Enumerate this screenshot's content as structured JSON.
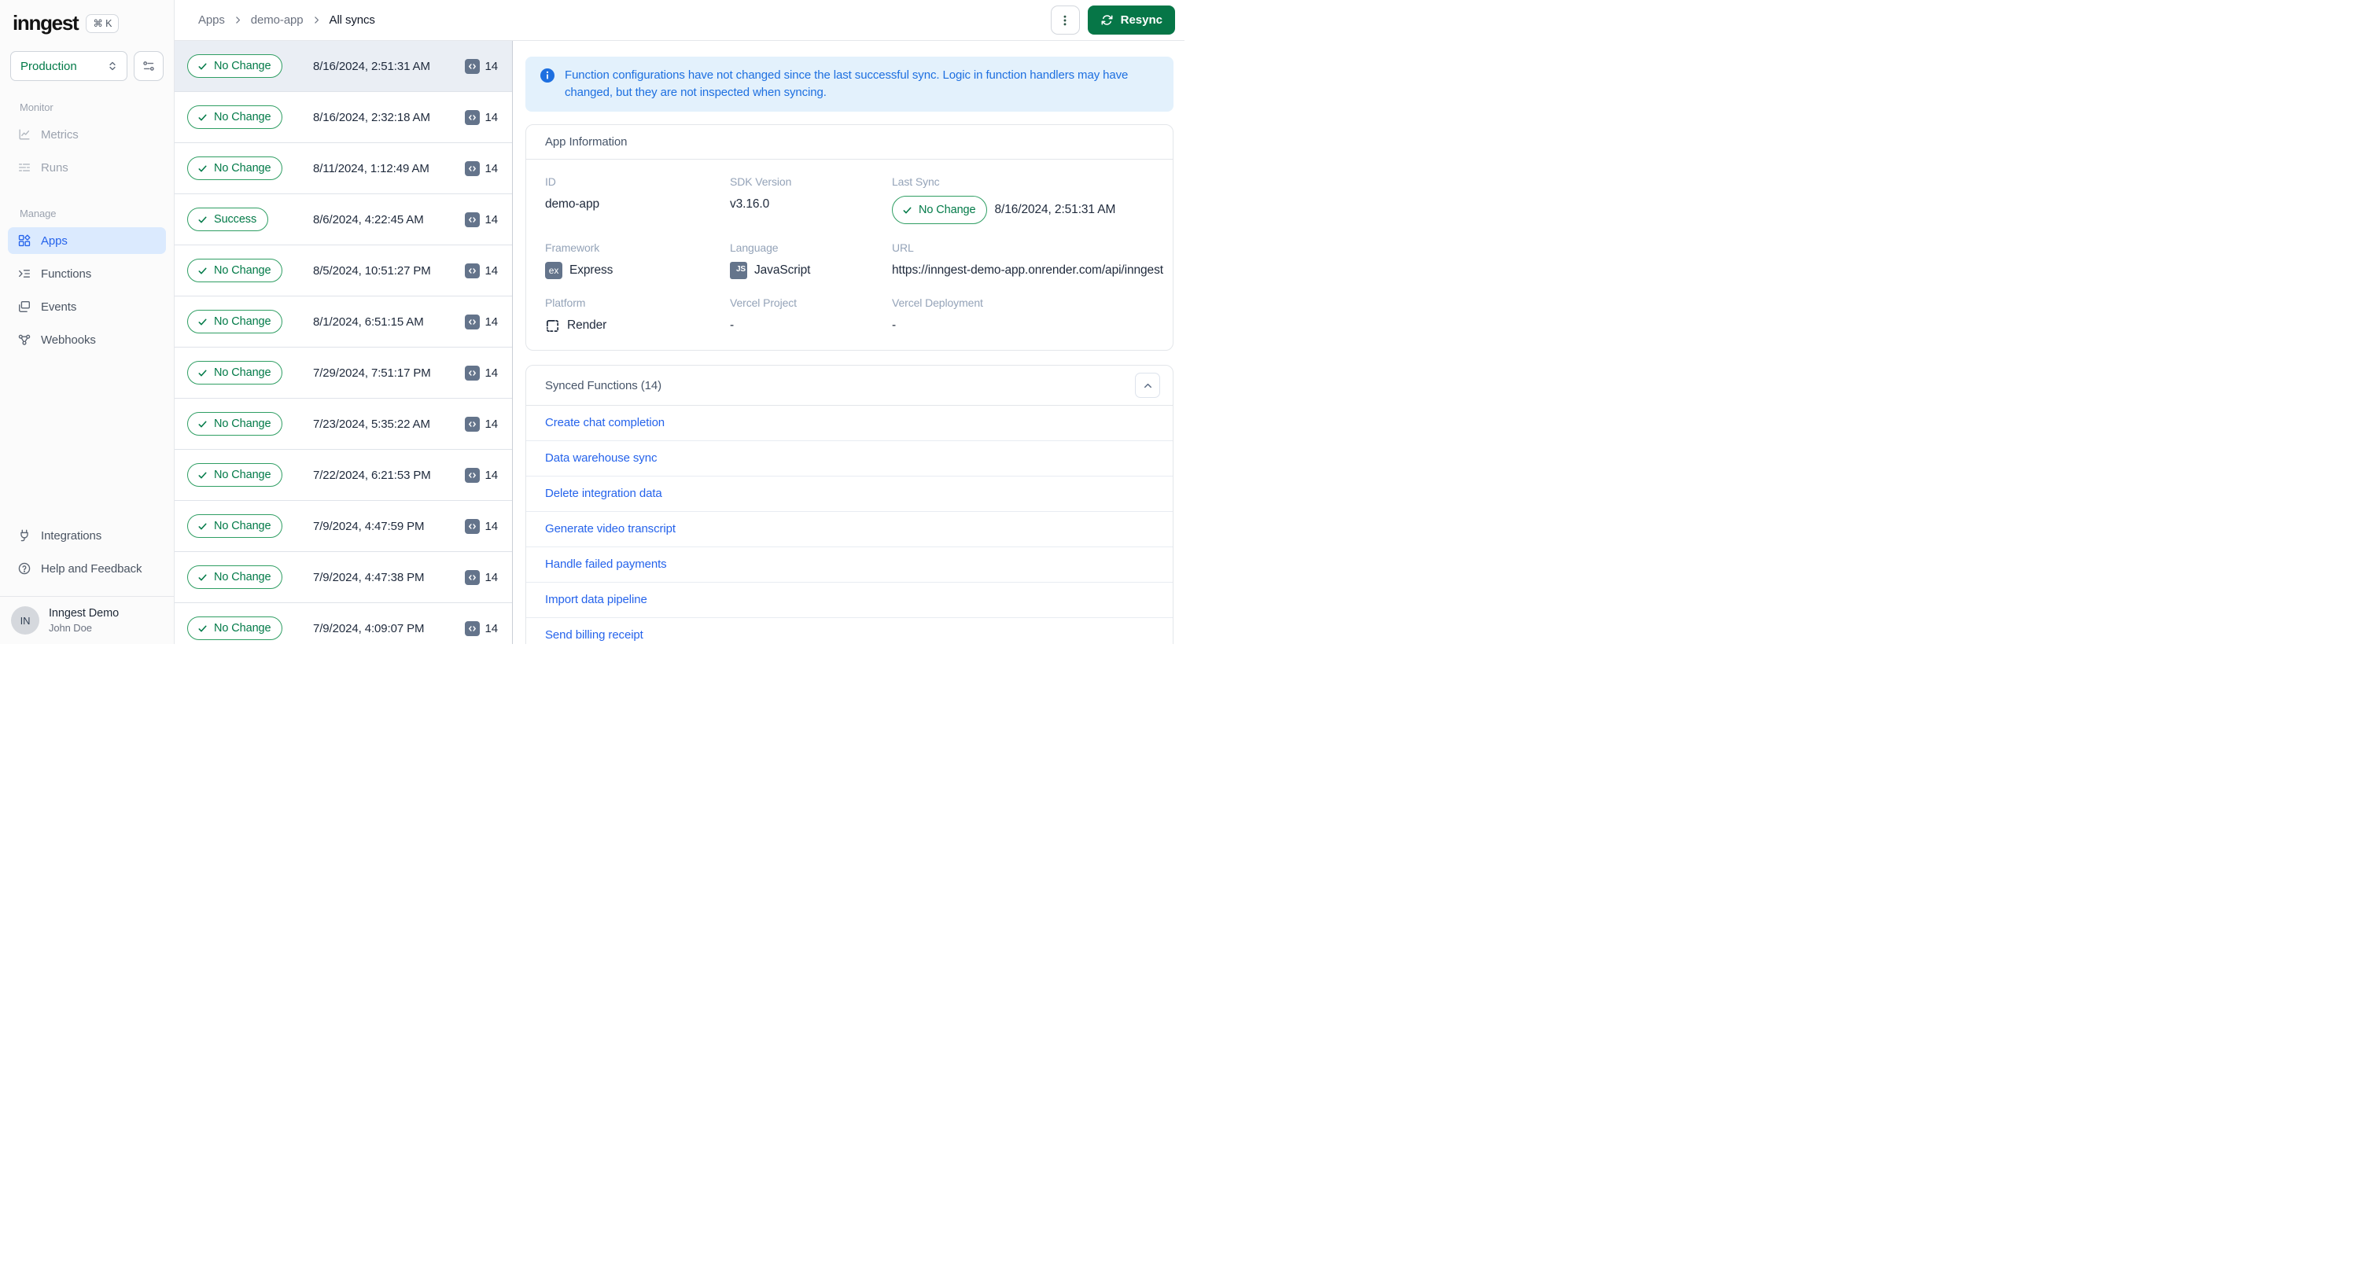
{
  "colors": {
    "brand_green": "#067647",
    "status_green_text": "#027a48",
    "status_green_border": "#2f9e63",
    "link_blue": "#2563eb",
    "banner_text_blue": "#1d6fe0",
    "banner_bg": "#e3f1fc",
    "nav_active_bg": "#dbeafe",
    "selected_row_bg": "#eaeef4",
    "chip_slate": "#64748b"
  },
  "sidebar": {
    "logo": "inngest",
    "shortcut": "⌘ K",
    "env_selector": "Production",
    "sections": [
      {
        "label": "Monitor",
        "items": [
          {
            "label": "Metrics"
          },
          {
            "label": "Runs"
          }
        ]
      },
      {
        "label": "Manage",
        "items": [
          {
            "label": "Apps",
            "active": true
          },
          {
            "label": "Functions"
          },
          {
            "label": "Events"
          },
          {
            "label": "Webhooks"
          }
        ]
      }
    ],
    "footer_items": [
      {
        "label": "Integrations"
      },
      {
        "label": "Help and Feedback"
      }
    ],
    "user": {
      "initials": "IN",
      "org": "Inngest Demo",
      "name": "John Doe"
    }
  },
  "header": {
    "breadcrumb": [
      "Apps",
      "demo-app",
      "All syncs"
    ],
    "resync_label": "Resync"
  },
  "sync_list": [
    {
      "status": "No Change",
      "timestamp": "8/16/2024, 2:51:31 AM",
      "count": "14",
      "selected": true
    },
    {
      "status": "No Change",
      "timestamp": "8/16/2024, 2:32:18 AM",
      "count": "14"
    },
    {
      "status": "No Change",
      "timestamp": "8/11/2024, 1:12:49 AM",
      "count": "14"
    },
    {
      "status": "Success",
      "timestamp": "8/6/2024, 4:22:45 AM",
      "count": "14"
    },
    {
      "status": "No Change",
      "timestamp": "8/5/2024, 10:51:27 PM",
      "count": "14"
    },
    {
      "status": "No Change",
      "timestamp": "8/1/2024, 6:51:15 AM",
      "count": "14"
    },
    {
      "status": "No Change",
      "timestamp": "7/29/2024, 7:51:17 PM",
      "count": "14"
    },
    {
      "status": "No Change",
      "timestamp": "7/23/2024, 5:35:22 AM",
      "count": "14"
    },
    {
      "status": "No Change",
      "timestamp": "7/22/2024, 6:21:53 PM",
      "count": "14"
    },
    {
      "status": "No Change",
      "timestamp": "7/9/2024, 4:47:59 PM",
      "count": "14"
    },
    {
      "status": "No Change",
      "timestamp": "7/9/2024, 4:47:38 PM",
      "count": "14"
    },
    {
      "status": "No Change",
      "timestamp": "7/9/2024, 4:09:07 PM",
      "count": "14"
    }
  ],
  "banner": {
    "text": "Function configurations have not changed since the last successful sync. Logic in function handlers may have changed, but they are not inspected when syncing."
  },
  "app_info": {
    "title": "App Information",
    "labels": {
      "id": "ID",
      "sdk": "SDK Version",
      "last_sync": "Last Sync",
      "framework": "Framework",
      "language": "Language",
      "url": "URL",
      "platform": "Platform",
      "vercel_project": "Vercel Project",
      "vercel_deployment": "Vercel Deployment"
    },
    "values": {
      "id": "demo-app",
      "sdk": "v3.16.0",
      "last_sync_badge": "No Change",
      "last_sync": "8/16/2024, 2:51:31 AM",
      "framework": "Express",
      "framework_icon": "ex",
      "language": "JavaScript",
      "language_icon": "JS",
      "url": "https://inngest-demo-app.onrender.com/api/inngest",
      "platform": "Render",
      "vercel_project": "-",
      "vercel_deployment": "-"
    }
  },
  "synced_functions": {
    "title": "Synced Functions (14)",
    "items": [
      {
        "label": "Create chat completion"
      },
      {
        "label": "Data warehouse sync"
      },
      {
        "label": "Delete integration data"
      },
      {
        "label": "Generate video transcript"
      },
      {
        "label": "Handle failed payments"
      },
      {
        "label": "Import data pipeline"
      },
      {
        "label": "Send billing receipt"
      }
    ]
  }
}
